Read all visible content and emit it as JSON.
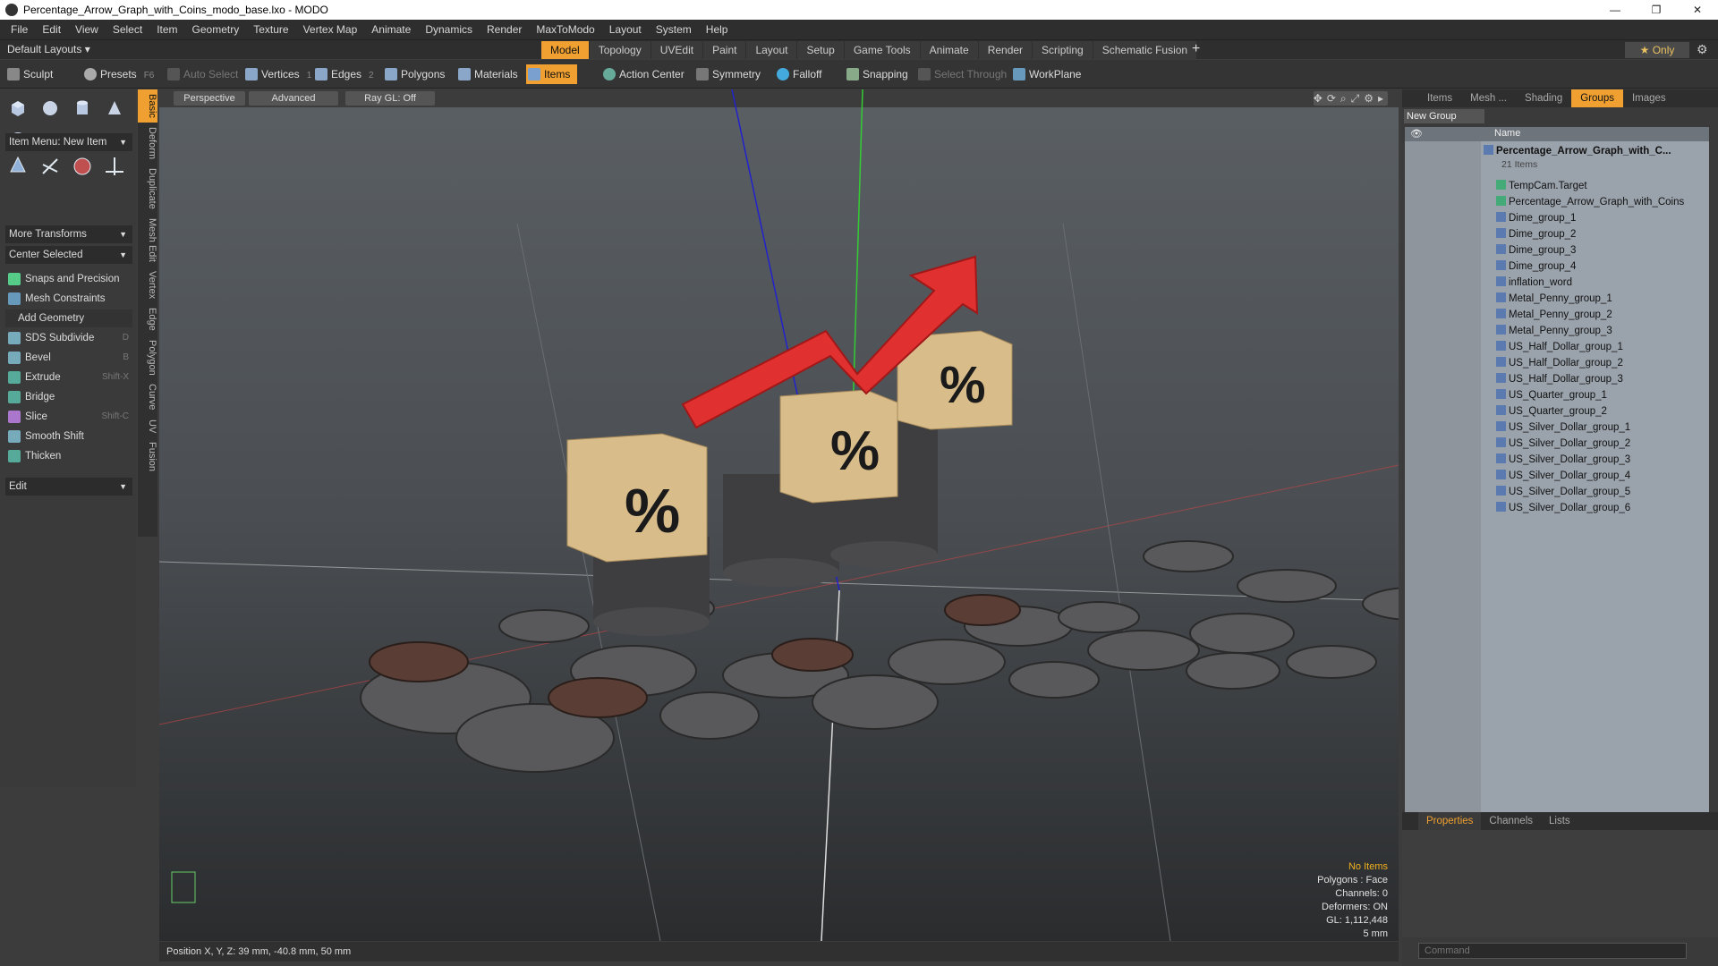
{
  "window": {
    "title": "Percentage_Arrow_Graph_with_Coins_modo_base.lxo - MODO",
    "minimize": "—",
    "maximize": "❐",
    "close": "✕"
  },
  "menu": [
    "File",
    "Edit",
    "View",
    "Select",
    "Item",
    "Geometry",
    "Texture",
    "Vertex Map",
    "Animate",
    "Dynamics",
    "Render",
    "MaxToModo",
    "Layout",
    "System",
    "Help"
  ],
  "layout": {
    "selector": "Default Layouts ▾",
    "tabs": [
      "Model",
      "Topology",
      "UVEdit",
      "Paint",
      "Layout",
      "Setup",
      "Game Tools",
      "Animate",
      "Render",
      "Scripting",
      "Schematic Fusion"
    ],
    "active_tab": "Model",
    "add": "+",
    "only": "★  Only"
  },
  "toolbar": {
    "sculpt": "Sculpt",
    "presets": "Presets",
    "presets_key": "F6",
    "auto_select": "Auto Select",
    "vertices": "Vertices",
    "vertices_n": "1",
    "edges": "Edges",
    "edges_n": "2",
    "polygons": "Polygons",
    "materials": "Materials",
    "items": "Items",
    "action_center": "Action Center",
    "symmetry": "Symmetry",
    "falloff": "Falloff",
    "snapping": "Snapping",
    "select_through": "Select Through",
    "workplane": "WorkPlane"
  },
  "left": {
    "item_menu": "Item Menu: New Item",
    "more_transforms": "More Transforms",
    "center_selected": "Center Selected",
    "snaps": "Snaps and Precision",
    "mesh_constraints": "Mesh Constraints",
    "add_geometry": "Add Geometry",
    "tools": [
      {
        "label": "SDS Subdivide",
        "key": "D"
      },
      {
        "label": "Bevel",
        "key": "B"
      },
      {
        "label": "Extrude",
        "key": "Shift-X"
      },
      {
        "label": "Bridge",
        "key": ""
      },
      {
        "label": "Slice",
        "key": "Shift-C"
      },
      {
        "label": "Smooth Shift",
        "key": ""
      },
      {
        "label": "Thicken",
        "key": ""
      }
    ],
    "edit": "Edit",
    "side_tabs": [
      "Basic",
      "Deform",
      "Duplicate",
      "Mesh Edit",
      "Vertex",
      "Edge",
      "Polygon",
      "Curve",
      "UV",
      "Fusion"
    ]
  },
  "viewport": {
    "perspective": "Perspective",
    "advanced": "Advanced",
    "raygl": "Ray GL: Off",
    "stats": {
      "no_items": "No Items",
      "polygons": "Polygons : Face",
      "channels": "Channels: 0",
      "deformers": "Deformers: ON",
      "gl": "GL: 1,112,448",
      "scale": "5 mm"
    },
    "percent": "%"
  },
  "status": {
    "position": "Position X, Y, Z:  39 mm, -40.8 mm, 50 mm"
  },
  "right": {
    "tabs": [
      "Items",
      "Mesh ...",
      "Shading",
      "Groups",
      "Images"
    ],
    "active_tab": "Groups",
    "new_group": "New Group",
    "name_col": "Name",
    "root": "Percentage_Arrow_Graph_with_C...",
    "root_count": "21 Items",
    "items": [
      "TempCam.Target",
      "Percentage_Arrow_Graph_with_Coins",
      "Dime_group_1",
      "Dime_group_2",
      "Dime_group_3",
      "Dime_group_4",
      "inflation_word",
      "Metal_Penny_group_1",
      "Metal_Penny_group_2",
      "Metal_Penny_group_3",
      "US_Half_Dollar_group_1",
      "US_Half_Dollar_group_2",
      "US_Half_Dollar_group_3",
      "US_Quarter_group_1",
      "US_Quarter_group_2",
      "US_Silver_Dollar_group_1",
      "US_Silver_Dollar_group_2",
      "US_Silver_Dollar_group_3",
      "US_Silver_Dollar_group_4",
      "US_Silver_Dollar_group_5",
      "US_Silver_Dollar_group_6"
    ],
    "bottom_tabs": [
      "Properties",
      "Channels",
      "Lists"
    ],
    "command_placeholder": "Command"
  }
}
